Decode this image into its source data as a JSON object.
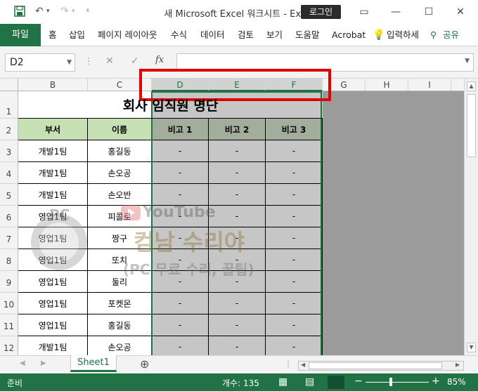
{
  "titlebar": {
    "title": "새 Microsoft Excel 워크시트  -  Excel",
    "login": "로그인"
  },
  "ribbon": {
    "file": "파일",
    "tabs": [
      "홈",
      "삽입",
      "페이지 레이아웃",
      "수식",
      "데이터",
      "검토",
      "보기",
      "도움말",
      "Acrobat",
      "입력하세",
      "공유"
    ]
  },
  "formula_bar": {
    "name_box": "D2",
    "fx": "fx",
    "value": ""
  },
  "columns": [
    "B",
    "C",
    "D",
    "E",
    "F",
    "G",
    "H",
    "I"
  ],
  "rows": [
    "1",
    "2",
    "3",
    "4",
    "5",
    "6",
    "7",
    "8",
    "9",
    "10",
    "11",
    "12"
  ],
  "sheet": {
    "title": "회사 임직원 명단",
    "headers": [
      "부서",
      "이름",
      "비고 1",
      "비고 2",
      "비고 3"
    ],
    "data": [
      [
        "개발1팀",
        "홍길동",
        "-",
        "-",
        "-"
      ],
      [
        "개발1팀",
        "손오공",
        "-",
        "-",
        "-"
      ],
      [
        "개발1팀",
        "손오반",
        "-",
        "-",
        "-"
      ],
      [
        "영업1팀",
        "피콜로",
        "-",
        "-",
        "-"
      ],
      [
        "영업1팀",
        "짱구",
        "-",
        "-",
        "-"
      ],
      [
        "영업1팀",
        "또치",
        "-",
        "-",
        "-"
      ],
      [
        "영업1팀",
        "둘리",
        "-",
        "-",
        "-"
      ],
      [
        "영업1팀",
        "포켓몬",
        "-",
        "-",
        "-"
      ],
      [
        "영업1팀",
        "홍길동",
        "-",
        "-",
        "-"
      ],
      [
        "개발1팀",
        "손오공",
        "-",
        "-",
        "-"
      ]
    ]
  },
  "watermark": {
    "pc": "PC",
    "youtube": "YouTube",
    "line1": "컴남 수리야",
    "line2": "(PC 무료 수리, 꿀팁)"
  },
  "tabs": {
    "sheet1": "Sheet1"
  },
  "status": {
    "ready": "준비",
    "count": "개수: 135",
    "zoom": "85%"
  },
  "colors": {
    "accent": "#217346",
    "highlight": "#e00000"
  }
}
